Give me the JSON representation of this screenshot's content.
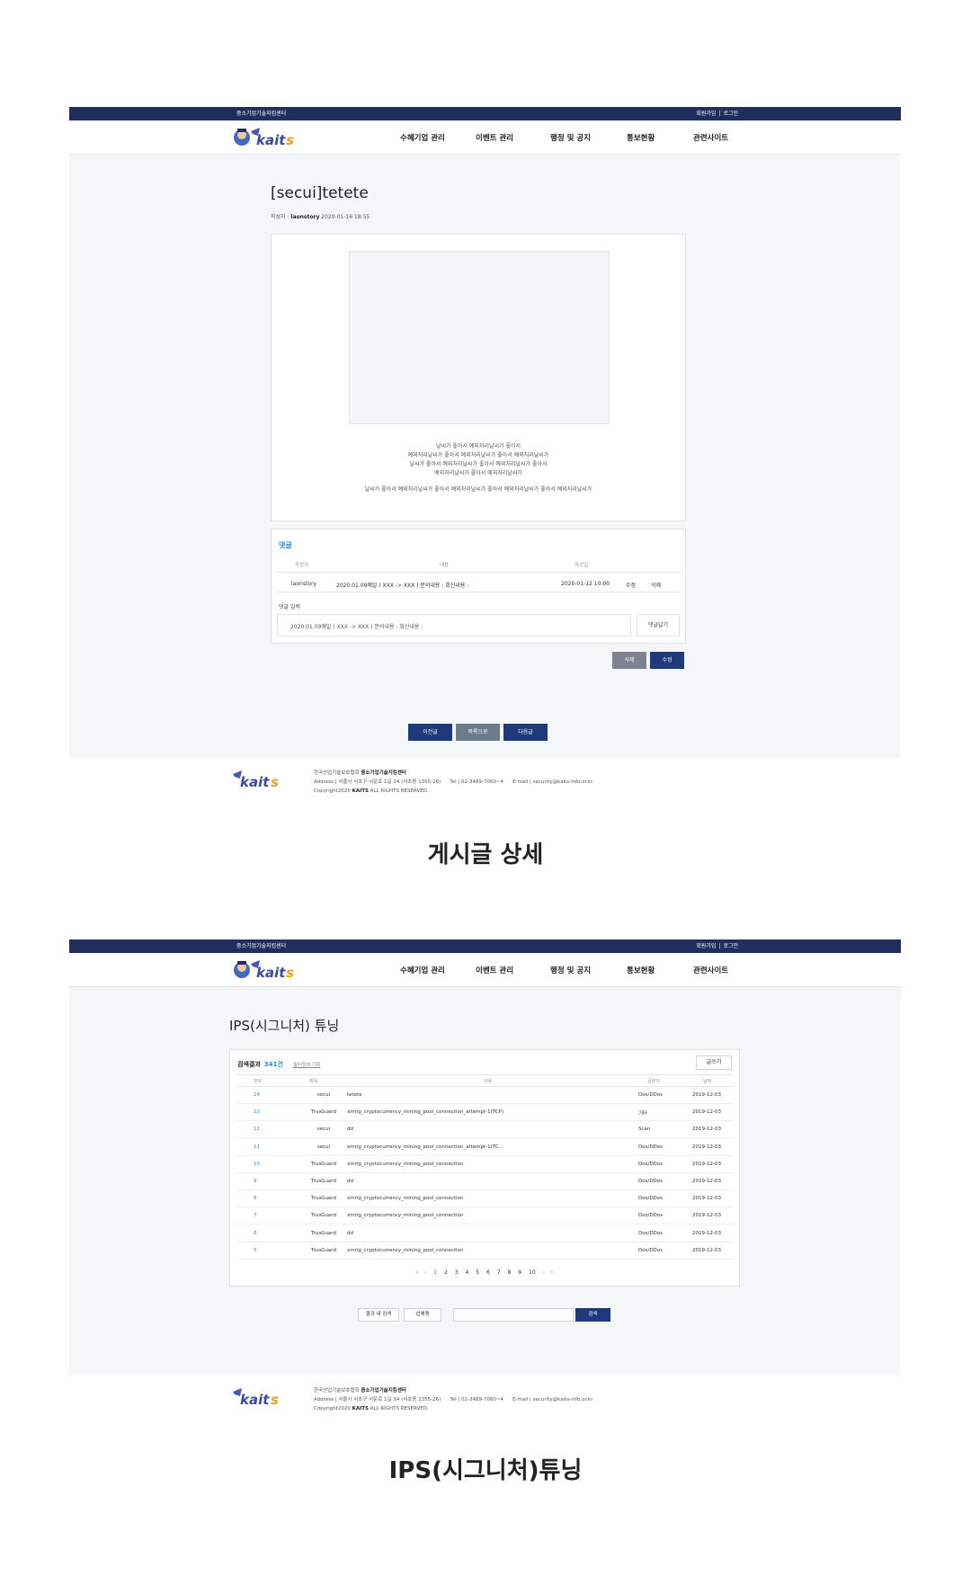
{
  "site": {
    "center_name": "중소기업기술지킴센터",
    "auth_links": [
      "회원가입",
      "로그인"
    ],
    "nav": [
      "수혜기업 관리",
      "이벤트 관리",
      "행정 및 공지",
      "통보현황",
      "관련사이트"
    ]
  },
  "detail": {
    "title": "[secui]tetete",
    "author_label": "작성자 :",
    "author": "laonstory",
    "date": "2020-01-16 18:55",
    "body_lines": [
      "날씨가 좋아서 예외처리날씨가 좋아서",
      "예외처리날씨가 좋아서 예외처리날씨가 좋아서 예외처리날씨가",
      "날씨가 좋아서 예외처리날씨가 좋아서 예외처리날씨가 좋아서",
      "예외처리날씨가 좋아서 예외처리날씨가"
    ],
    "body_line_last": "날씨가 좋아서 예외처리날씨가 좋아서 예외처리날씨가 좋아서 예외처리날씨가 좋아서 예외처리날씨가",
    "comments": {
      "title": "댓글",
      "headers": [
        "작성자",
        "내용",
        "작성일"
      ],
      "row": {
        "author": "laonstory",
        "content": "2020.01.09예알 ( XXX -> XXX ) 문의내용 : 회신내용 :",
        "date": "2020-01-12 10:00",
        "edit": "수정",
        "delete": "삭제"
      },
      "input_label": "댓글 입력",
      "input_value": "2020.01.09예알 ( XXX -> XXX ) 문의내용 : 회신내용 :",
      "submit": "댓글달기"
    },
    "actions": {
      "delete": "삭제",
      "edit": "수정"
    },
    "nav_buttons": {
      "prev": "이전글",
      "list": "목록으로",
      "next": "다음글"
    },
    "caption": "게시글 상세"
  },
  "footer": {
    "org": "한국산업기술보호협회",
    "center": "중소기업기술지킴센터",
    "address": "Address | 서울시 서초구 서운로 1길 34 (서초동 1355-26)",
    "tel": "Tel | 02-3489-7060~4",
    "email_1": "E-mail | security@kaits-info.or.kr",
    "email_2": "E-mail | security@kaits-info.or.kr",
    "copyright_prefix": "Copyright2020 ",
    "copyright_brand": "KAITS",
    "copyright_suffix": " ALL RIGHTS RESERVED."
  },
  "list": {
    "title": "IPS(시그니처) 튜닝",
    "result_label": "검색결과",
    "result_count": "341건",
    "filter_reset": "필터링초기화",
    "write": "글쓰기",
    "headers": [
      "번호",
      "제목",
      "내용",
      "글분리",
      "날짜"
    ],
    "rows": [
      {
        "num": "14",
        "title": "secui",
        "content": "tetete",
        "category": "Dos/DDos",
        "date": "2019-12-03"
      },
      {
        "num": "13",
        "title": "TrusGuard",
        "content": "xmrig_cryptocurrency_mining_pool_connection_attempt-1(TCP)",
        "category": "기타",
        "date": "2019-12-03"
      },
      {
        "num": "12",
        "title": "secui",
        "content": "dd",
        "category": "Scan",
        "date": "2019-12-03"
      },
      {
        "num": "11",
        "title": "secui",
        "content": "xmrig_cryptocurrency_mining_pool_connection_attempt-1(TC...",
        "category": "Dos/DDos",
        "date": "2019-12-03"
      },
      {
        "num": "10",
        "title": "TrusGuard",
        "content": "xmrig_cryptocurrency_mining_pool_connection",
        "category": "Dos/DDos",
        "date": "2019-12-03"
      },
      {
        "num": "9",
        "title": "TrusGuard",
        "content": "dd",
        "category": "Dos/DDos",
        "date": "2019-12-03"
      },
      {
        "num": "8",
        "title": "TrusGuard",
        "content": "xmrig_cryptocurrency_mining_pool_connection",
        "category": "Dos/DDos",
        "date": "2019-12-03"
      },
      {
        "num": "7",
        "title": "TrusGuard",
        "content": "xmrig_cryptocurrency_mining_pool_connection",
        "category": "Dos/DDos",
        "date": "2019-12-03"
      },
      {
        "num": "6",
        "title": "TrusGuard",
        "content": "dd",
        "category": "Dos/DDos",
        "date": "2019-12-03"
      },
      {
        "num": "5",
        "title": "TrusGuard",
        "content": "xmrig_cryptocurrency_mining_pool_connection",
        "category": "Dos/DDos",
        "date": "2019-12-03"
      }
    ],
    "pager": {
      "first": "«",
      "prev": "‹",
      "pages": [
        "1",
        "2",
        "3",
        "4",
        "5",
        "6",
        "7",
        "8",
        "9",
        "10"
      ],
      "next": "›",
      "last": "»",
      "current_page": "1"
    },
    "search": {
      "scope": "결과 내 검색",
      "field": "업체명",
      "query": "",
      "button": "검색"
    },
    "caption": "IPS(시그니처)튜닝"
  },
  "colors": {
    "navy": "#1e2f5f",
    "accent_blue": "#1a8fd8",
    "button_navy": "#1e3a7a",
    "page_bg": "#f5f6f8"
  }
}
